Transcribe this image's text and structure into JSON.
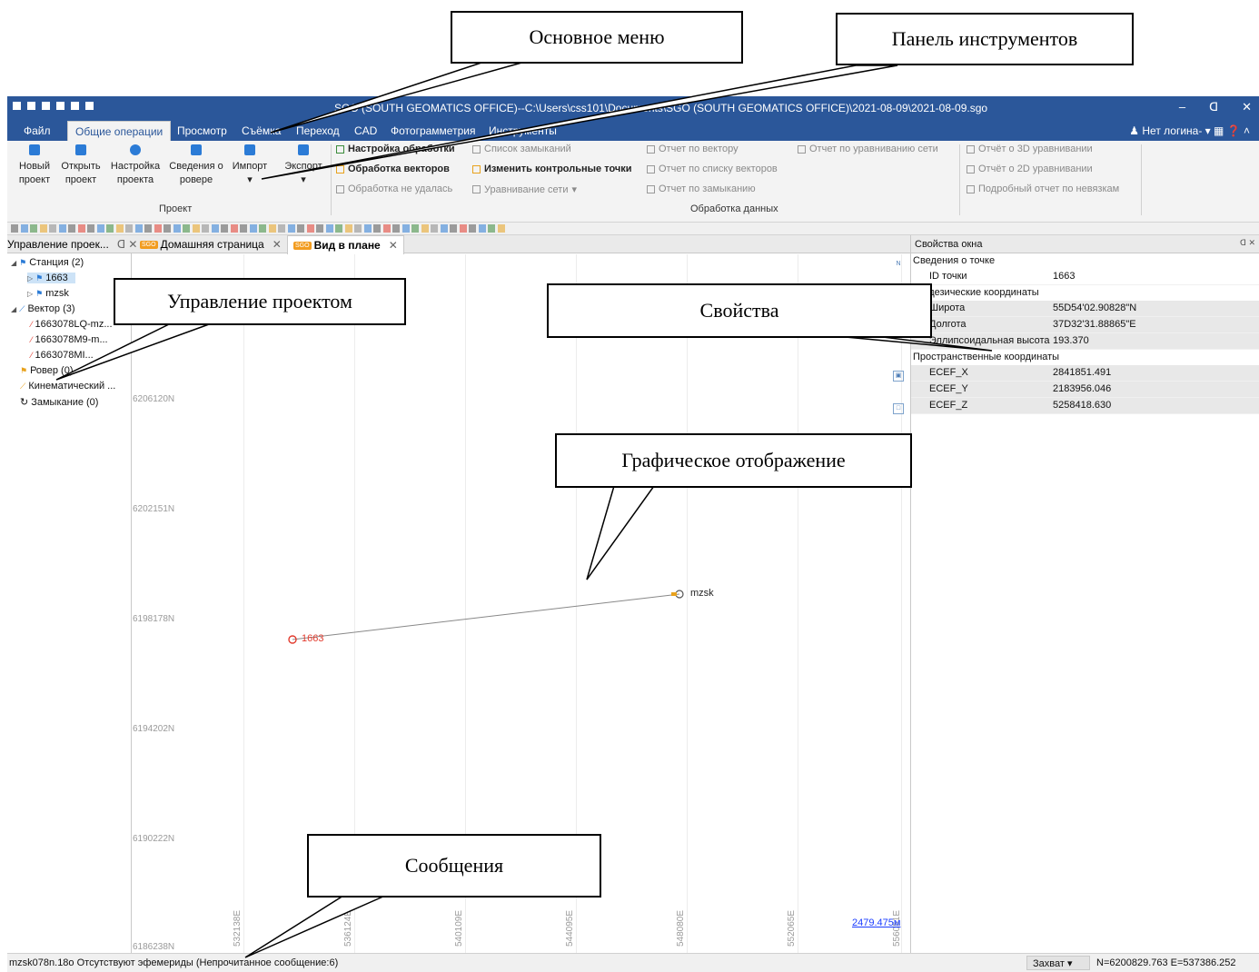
{
  "callouts": {
    "main_menu": "Основное меню",
    "toolbar": "Панель инструментов",
    "project_mgmt": "Управление проектом",
    "properties": "Свойства",
    "graphics": "Графическое отображение",
    "messages": "Сообщения"
  },
  "window": {
    "title_left": "SGO (SOUTH GEOMATICS OFFICE)--C:\\Users\\css101\\Documents\\",
    "title_right": "SGO (SOUTH GEOMATICS OFFICE)\\2021-08-09\\2021-08-09.sgo",
    "title": "SGO (SOUTH GEOMATICS OFFICE)--C:\\Users\\css101\\Documents\\SGO (SOUTH GEOMATICS OFFICE)\\2021-08-09\\2021-08-09.sgo",
    "minimize": "–",
    "restore": "ᗡ",
    "close": "✕"
  },
  "menu": {
    "items": [
      "Файл",
      "Общие операции",
      "Просмотр",
      "Съёмка",
      "Переход",
      "CAD",
      "Фотограмметрия",
      "Инструменты"
    ],
    "active": "Общие операции",
    "user": "Нет логина-"
  },
  "ribbon": {
    "project_buttons": [
      {
        "l1": "Новый",
        "l2": "проект"
      },
      {
        "l1": "Открыть",
        "l2": "проект"
      },
      {
        "l1": "Настройка",
        "l2": "проекта"
      },
      {
        "l1": "Сведения о",
        "l2": "ровере"
      },
      {
        "l1": "Импорт",
        "l2": "▾"
      },
      {
        "l1": "Экспорт",
        "l2": "▾"
      }
    ],
    "project_group": "Проект",
    "processing_col1": [
      "Настройка обработки",
      "Обработка векторов",
      "Обработка не удалась"
    ],
    "processing_col2": [
      "Список замыканий",
      "Изменить контрольные точки",
      "Уравнивание сети"
    ],
    "reports_col3": [
      "Отчет по вектору",
      "Отчет по списку векторов",
      "Отчет по замыканию"
    ],
    "reports_col4": [
      "Отчет по уравниванию сети"
    ],
    "reports_col5": [
      "Отчёт о 3D уравнивании",
      "Отчёт о 2D уравнивании",
      "Подробный отчет по невязкам"
    ],
    "data_group": "Обработка данных"
  },
  "tabs": {
    "project_panel": "Управление проек...",
    "home": "Домашняя страница",
    "plan": "Вид в плане",
    "badge": "SGO"
  },
  "tree": {
    "station": "Станция (2)",
    "st1": "1663",
    "st2": "mzsk",
    "vector": "Вектор (3)",
    "v1": "1663078LQ-mz...",
    "v2": "1663078M9-m...",
    "v3": "1663078MI...",
    "rover": "Ровер (0)",
    "kinematic": "Кинематический ...",
    "closure": "Замыкание (0)"
  },
  "plan": {
    "y_labels": [
      "6206120N",
      "6202151N",
      "6198178N",
      "6194202N",
      "6190222N",
      "6186238N"
    ],
    "x_labels": [
      "532138E",
      "536124E",
      "540109E",
      "544095E",
      "548080E",
      "552065E",
      "556051E"
    ],
    "point1": "1663",
    "point2": "mzsk",
    "scale": "2479.475м"
  },
  "properties": {
    "title": "Свойства окна",
    "cat1": "Сведения о точке",
    "id_key": "ID точки",
    "id_val": "1663",
    "cat2": "Геодезические координаты",
    "lat_key": "Широта",
    "lat_val": "55D54'02.90828\"N",
    "lon_key": "Долгота",
    "lon_val": "37D32'31.88865\"E",
    "h_key": "Эллипсоидальная высота",
    "h_val": "193.370",
    "cat3": "Пространственные координаты",
    "x_key": "ECEF_X",
    "x_val": "2841851.491",
    "y_key": "ECEF_Y",
    "y_val": "2183956.046",
    "z_key": "ECEF_Z",
    "z_val": "5258418.630"
  },
  "status": {
    "message": "mzsk078n.18o Отсутствуют эфемериды (Непрочитанное сообщение:6)",
    "capture": "Захват",
    "coords": "N=6200829.763  E=537386.252"
  },
  "colors": {
    "title_blue": "#2b579a",
    "point_red": "#e23b2e",
    "point_orange": "#e8a21d"
  }
}
